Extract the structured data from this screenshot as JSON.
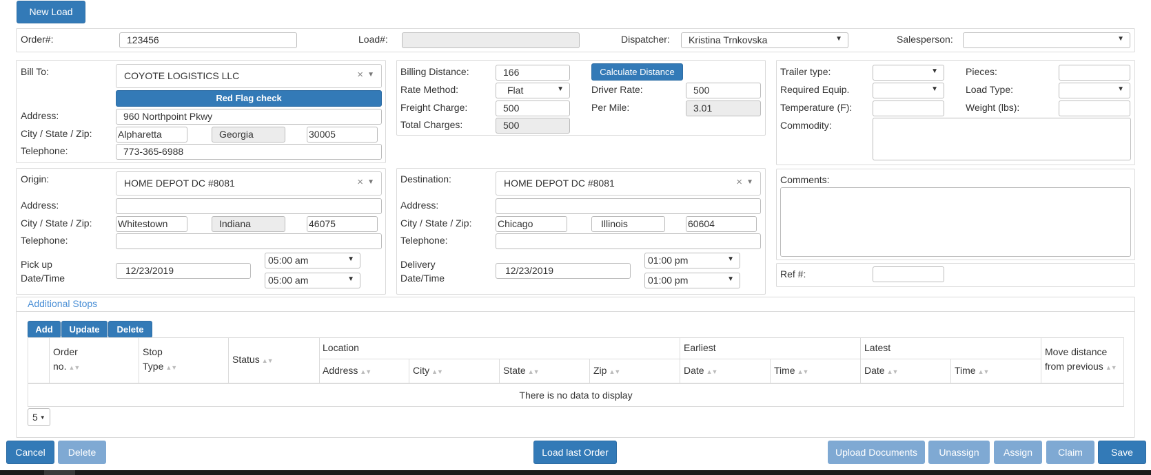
{
  "toolbar": {
    "new_load": "New Load"
  },
  "header": {
    "order_label": "Order#:",
    "order_value": "123456",
    "load_label": "Load#:",
    "load_value": "",
    "dispatcher_label": "Dispatcher:",
    "dispatcher_value": "Kristina Trnkovska",
    "salesperson_label": "Salesperson:",
    "salesperson_value": ""
  },
  "bill_to": {
    "label": "Bill To:",
    "value": "COYOTE LOGISTICS LLC",
    "red_flag": "Red Flag check",
    "address_label": "Address:",
    "address": "960 Northpoint Pkwy",
    "csz_label": "City / State / Zip:",
    "city": "Alpharetta",
    "state": "Georgia",
    "zip": "30005",
    "phone_label": "Telephone:",
    "phone": "773-365-6988"
  },
  "billing": {
    "distance_label": "Billing Distance:",
    "distance": "166",
    "calc_button": "Calculate Distance",
    "rate_method_label": "Rate Method:",
    "rate_method": "Flat",
    "driver_rate_label": "Driver Rate:",
    "driver_rate": "500",
    "freight_label": "Freight Charge:",
    "freight": "500",
    "per_mile_label": "Per Mile:",
    "per_mile": "3.01",
    "total_label": "Total Charges:",
    "total": "500"
  },
  "details": {
    "trailer_label": "Trailer type:",
    "trailer": "",
    "pieces_label": "Pieces:",
    "pieces": "",
    "equip_label": "Required Equip.",
    "equip": "",
    "load_type_label": "Load Type:",
    "load_type": "",
    "temp_label": "Temperature (F):",
    "temp": "",
    "weight_label": "Weight (lbs):",
    "weight": "",
    "commodity_label": "Commodity:"
  },
  "origin": {
    "label": "Origin:",
    "value": "HOME DEPOT DC #8081",
    "address_label": "Address:",
    "address": "",
    "csz_label": "City / State / Zip:",
    "city": "Whitestown",
    "state": "Indiana",
    "zip": "46075",
    "phone_label": "Telephone:",
    "phone": "",
    "date_label_1": "Pick up",
    "date_label_2": "Date/Time",
    "date": "12/23/2019",
    "time_from": "05:00 am",
    "time_to": "05:00 am"
  },
  "destination": {
    "label": "Destination:",
    "value": "HOME DEPOT DC #8081",
    "address_label": "Address:",
    "address": "",
    "csz_label": "City / State / Zip:",
    "city": "Chicago",
    "state": "Illinois",
    "zip": "60604",
    "phone_label": "Telephone:",
    "phone": "",
    "date_label_1": "Delivery",
    "date_label_2": "Date/Time",
    "date": "12/23/2019",
    "time_from": "01:00 pm",
    "time_to": "01:00 pm"
  },
  "comments": {
    "label": "Comments:",
    "ref_label": "Ref #:",
    "ref": ""
  },
  "stops": {
    "title": "Additional Stops",
    "add": "Add",
    "update": "Update",
    "delete": "Delete",
    "headers": {
      "order_1": "Order",
      "order_2": "no.",
      "stop_1": "Stop",
      "stop_2": "Type",
      "status": "Status",
      "location": "Location",
      "address": "Address",
      "city": "City",
      "state": "State",
      "zip": "Zip",
      "earliest": "Earliest",
      "latest": "Latest",
      "date": "Date",
      "time": "Time",
      "move_1": "Move distance",
      "move_2": "from previous"
    },
    "empty": "There is no data to display",
    "page_size": "5"
  },
  "footer": {
    "cancel": "Cancel",
    "delete": "Delete",
    "load_last": "Load last Order",
    "upload": "Upload Documents",
    "unassign": "Unassign",
    "assign": "Assign",
    "claim": "Claim",
    "save": "Save"
  }
}
